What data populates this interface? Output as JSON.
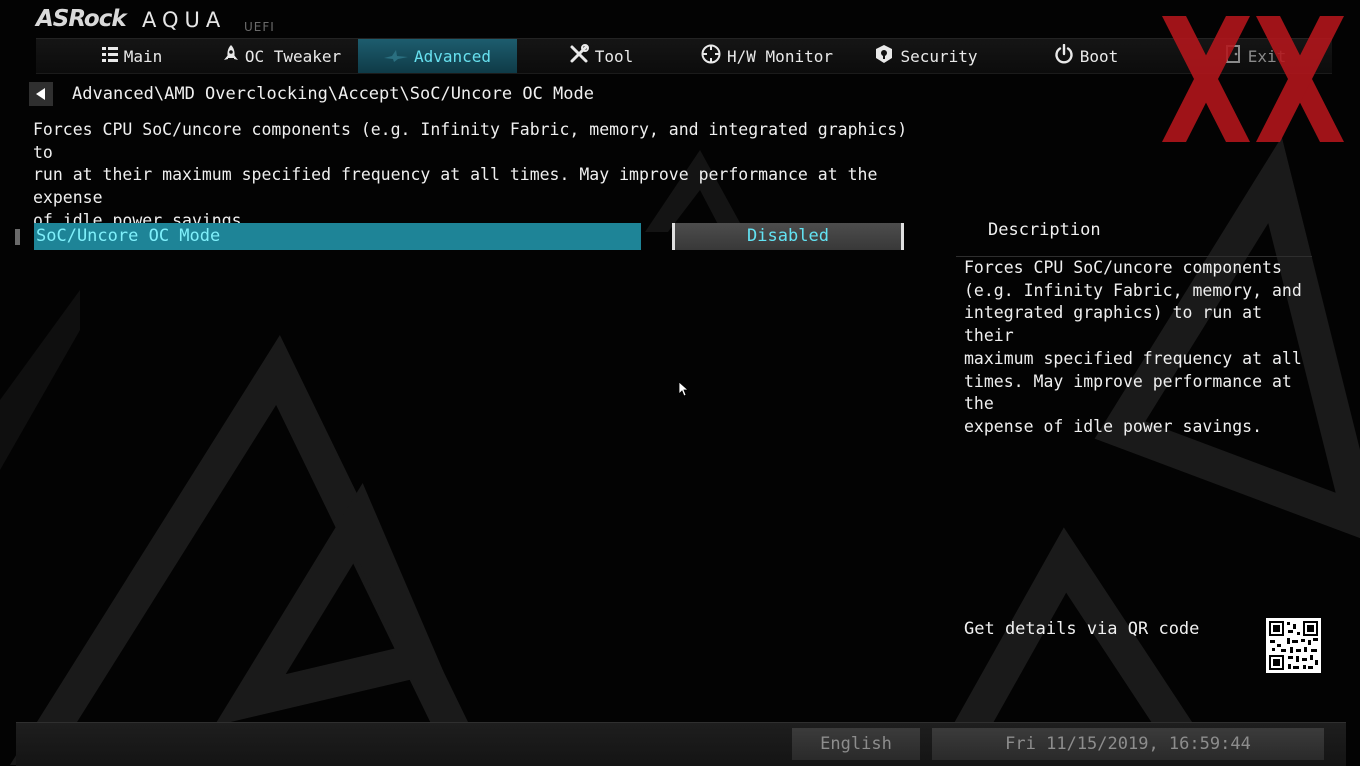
{
  "logo": {
    "brand": "ASRock",
    "product": "AQUA",
    "sub": "UEFI"
  },
  "tabs": [
    {
      "label": "Main",
      "icon": "list-icon"
    },
    {
      "label": "OC Tweaker",
      "icon": "rocket-icon"
    },
    {
      "label": "Advanced",
      "icon": "shark-icon",
      "active": true
    },
    {
      "label": "Tool",
      "icon": "tools-icon"
    },
    {
      "label": "H/W Monitor",
      "icon": "crosshair-icon"
    },
    {
      "label": "Security",
      "icon": "shield-icon"
    },
    {
      "label": "Boot",
      "icon": "power-icon"
    },
    {
      "label": "Exit",
      "icon": "exit-door-icon"
    }
  ],
  "breadcrumb": "Advanced\\AMD Overclocking\\Accept\\SoC/Uncore OC Mode",
  "top_description": "Forces CPU SoC/uncore components (e.g. Infinity Fabric, memory, and integrated graphics) to\nrun at their maximum specified frequency at all times. May improve performance at the expense\nof idle power savings.",
  "option": {
    "label": "SoC/Uncore OC Mode",
    "value": "Disabled"
  },
  "description_panel": {
    "heading": "Description",
    "text": "Forces CPU SoC/uncore components\n(e.g. Infinity Fabric, memory, and\nintegrated graphics) to run at their\nmaximum specified frequency at all\ntimes. May improve performance at the\nexpense of idle power savings.",
    "qr_label": "Get details via QR code"
  },
  "footer": {
    "language": "English",
    "datetime": "Fri 11/15/2019, 16:59:44"
  },
  "colors": {
    "accent": "#1e8497",
    "accent_text": "#7ff0fb",
    "value_text": "#63e3f3",
    "watermark_red": "#b5161c"
  }
}
